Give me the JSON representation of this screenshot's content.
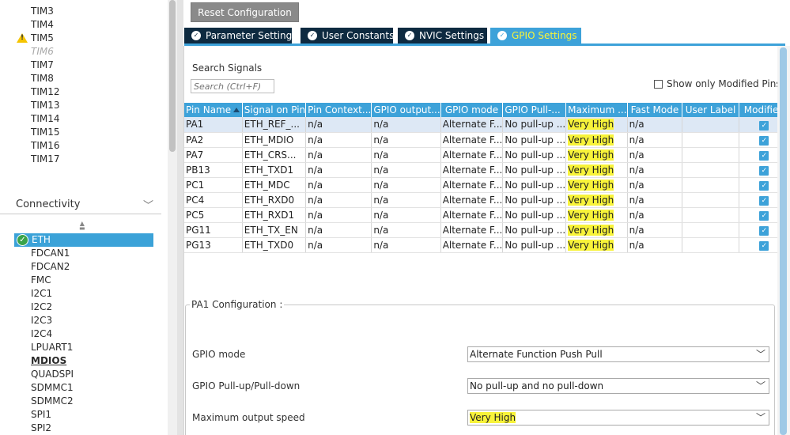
{
  "sidebar": {
    "timers": [
      "TIM3",
      "TIM4",
      "TIM5",
      "TIM6",
      "TIM7",
      "TIM8",
      "TIM12",
      "TIM13",
      "TIM14",
      "TIM15",
      "TIM16",
      "TIM17"
    ],
    "connectivity_label": "Connectivity",
    "selected_item": "ETH",
    "connectivity": [
      "FDCAN1",
      "FDCAN2",
      "FMC",
      "I2C1",
      "I2C2",
      "I2C3",
      "I2C4",
      "LPUART1",
      "MDIOS",
      "QUADSPI",
      "SDMMC1",
      "SDMMC2",
      "SPI1",
      "SPI2"
    ]
  },
  "toolbar": {
    "reset_label": "Reset Configuration"
  },
  "tabs": [
    {
      "label": "Parameter Settings"
    },
    {
      "label": "User Constants"
    },
    {
      "label": "NVIC Settings"
    },
    {
      "label": "GPIO Settings"
    }
  ],
  "search": {
    "label": "Search Signals",
    "placeholder": "Search (Ctrl+F)"
  },
  "filter": {
    "show_modified_label": "Show only Modified Pins"
  },
  "table": {
    "headers": [
      "Pin Name",
      "Signal on Pin",
      "Pin Context...",
      "GPIO output...",
      "GPIO mode",
      "GPIO Pull-...",
      "Maximum ...",
      "Fast Mode",
      "User Label",
      "Modified"
    ],
    "rows": [
      [
        "PA1",
        "ETH_REF_...",
        "n/a",
        "n/a",
        "Alternate F...",
        "No pull-up ...",
        "Very High",
        "n/a",
        "",
        "✓"
      ],
      [
        "PA2",
        "ETH_MDIO",
        "n/a",
        "n/a",
        "Alternate F...",
        "No pull-up ...",
        "Very High",
        "n/a",
        "",
        "✓"
      ],
      [
        "PA7",
        "ETH_CRS...",
        "n/a",
        "n/a",
        "Alternate F...",
        "No pull-up ...",
        "Very High",
        "n/a",
        "",
        "✓"
      ],
      [
        "PB13",
        "ETH_TXD1",
        "n/a",
        "n/a",
        "Alternate F...",
        "No pull-up ...",
        "Very High",
        "n/a",
        "",
        "✓"
      ],
      [
        "PC1",
        "ETH_MDC",
        "n/a",
        "n/a",
        "Alternate F...",
        "No pull-up ...",
        "Very High",
        "n/a",
        "",
        "✓"
      ],
      [
        "PC4",
        "ETH_RXD0",
        "n/a",
        "n/a",
        "Alternate F...",
        "No pull-up ...",
        "Very High",
        "n/a",
        "",
        "✓"
      ],
      [
        "PC5",
        "ETH_RXD1",
        "n/a",
        "n/a",
        "Alternate F...",
        "No pull-up ...",
        "Very High",
        "n/a",
        "",
        "✓"
      ],
      [
        "PG11",
        "ETH_TX_EN",
        "n/a",
        "n/a",
        "Alternate F...",
        "No pull-up ...",
        "Very High",
        "n/a",
        "",
        "✓"
      ],
      [
        "PG13",
        "ETH_TXD0",
        "n/a",
        "n/a",
        "Alternate F...",
        "No pull-up ...",
        "Very High",
        "n/a",
        "",
        "✓"
      ]
    ]
  },
  "config": {
    "title": "PA1 Configuration :",
    "fields": [
      {
        "label": "GPIO mode",
        "value": "Alternate Function Push Pull"
      },
      {
        "label": "GPIO Pull-up/Pull-down",
        "value": "No pull-up and no pull-down"
      },
      {
        "label": "Maximum output speed",
        "value": "Very High"
      }
    ]
  },
  "colors": {
    "accent": "#3da2d9",
    "tab_dark": "#0e2a40",
    "highlight": "#f8f33a",
    "eth_ok": "#39a34a",
    "warning": "#f5c400"
  }
}
